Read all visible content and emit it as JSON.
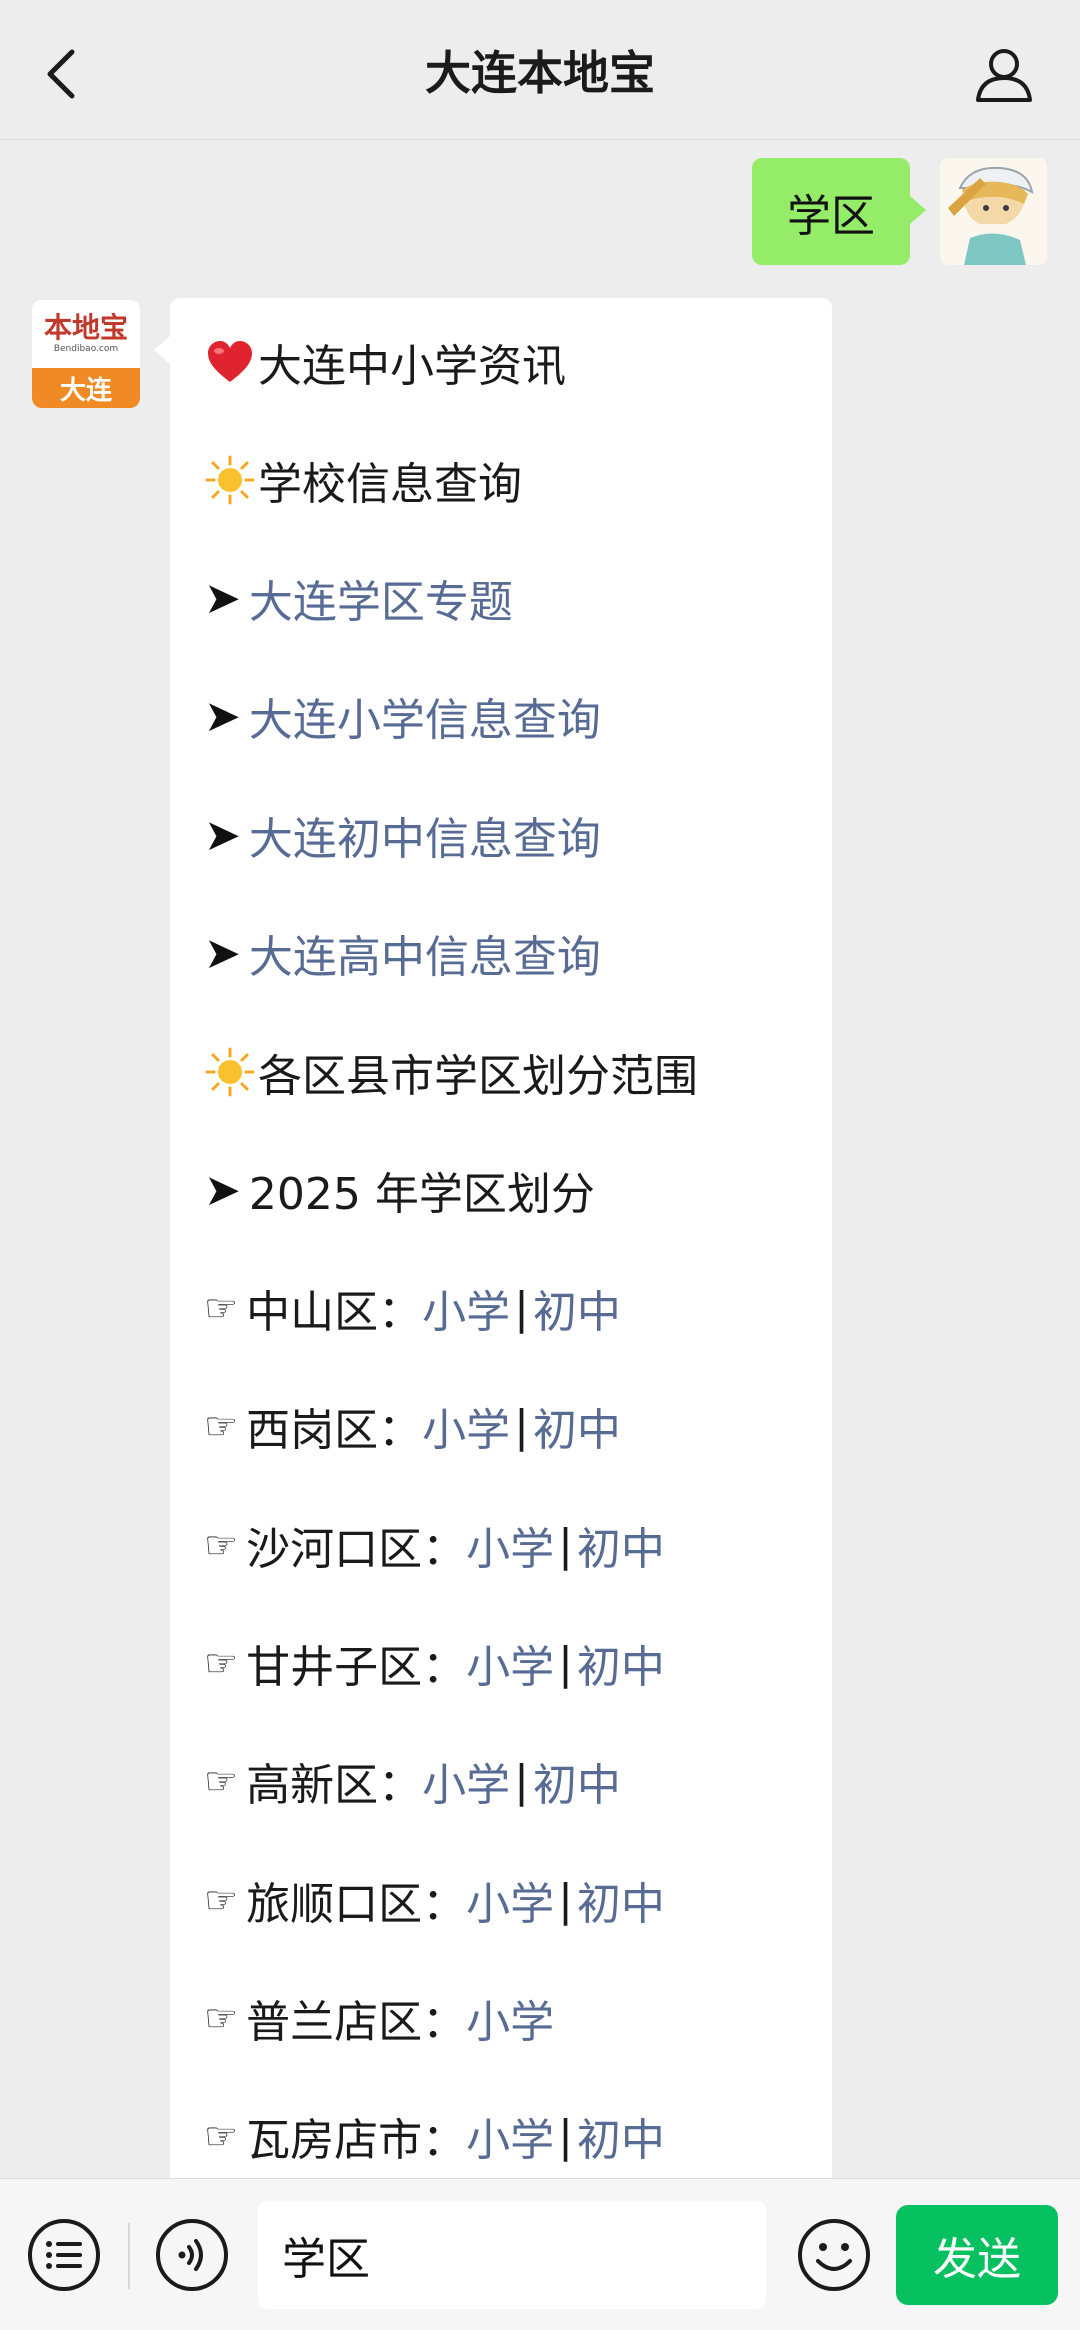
{
  "header": {
    "title": "大连本地宝",
    "back_icon": "back-chevron-icon",
    "profile_icon": "user-profile-icon"
  },
  "user_message": {
    "text": "学区"
  },
  "bot_avatar": {
    "logo_text": "本地宝",
    "logo_sub": "Bendibao.com",
    "city": "大连"
  },
  "bot_message": {
    "lines": [
      {
        "marker": "heart",
        "text": "大连中小学资讯",
        "style": "plain"
      },
      {
        "marker": "sun",
        "text": "学校信息查询",
        "style": "plain"
      },
      {
        "marker": "➤",
        "text": "大连学区专题",
        "style": "link"
      },
      {
        "marker": "➤",
        "text": "大连小学信息查询",
        "style": "link"
      },
      {
        "marker": "➤",
        "text": "大连初中信息查询",
        "style": "link"
      },
      {
        "marker": "➤",
        "text": "大连高中信息查询",
        "style": "link"
      },
      {
        "marker": "sun",
        "text": "各区县市学区划分范围",
        "style": "plain"
      },
      {
        "marker": "➤",
        "text": "2025 年学区划分",
        "style": "plain"
      }
    ],
    "districts": [
      {
        "label": "中山区：",
        "primary": "小学",
        "separator": "|",
        "junior": "初中"
      },
      {
        "label": "西岗区：",
        "primary": "小学",
        "separator": "|",
        "junior": "初中"
      },
      {
        "label": "沙河口区：",
        "primary": "小学",
        "separator": "|",
        "junior": "初中"
      },
      {
        "label": "甘井子区：",
        "primary": "小学",
        "separator": "|",
        "junior": "初中"
      },
      {
        "label": "高新区：",
        "primary": "小学",
        "separator": "|",
        "junior": "初中"
      },
      {
        "label": "旅顺口区：",
        "primary": "小学",
        "separator": "|",
        "junior": "初中"
      },
      {
        "label": "普兰店区：",
        "primary": "小学",
        "separator": "",
        "junior": ""
      },
      {
        "label": "瓦房店市：",
        "primary": "小学",
        "separator": "|",
        "junior": "初中"
      }
    ],
    "hand_glyph": "☞"
  },
  "input_bar": {
    "menu_icon": "menu-list-icon",
    "voice_icon": "voice-icon",
    "input_value": "学区",
    "emoji_icon": "emoji-icon",
    "send_label": "发送"
  },
  "colors": {
    "background": "#ededed",
    "user_bubble": "#95ec69",
    "link": "#576b95",
    "send_button": "#07c160",
    "avatar_orange": "#f08a24"
  }
}
